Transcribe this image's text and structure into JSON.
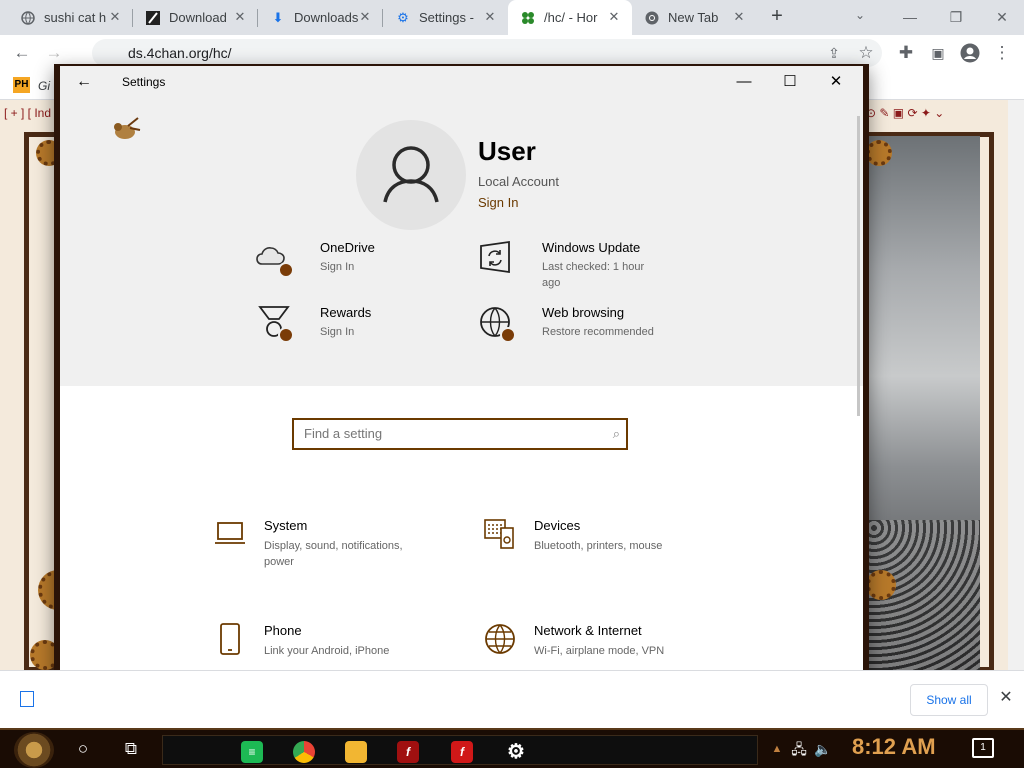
{
  "browser": {
    "tabs": [
      {
        "title": "sushi cat h",
        "icon": "globe-icon"
      },
      {
        "title": "Download",
        "icon": "download-page-icon"
      },
      {
        "title": "Downloads",
        "icon": "download-icon"
      },
      {
        "title": "Settings -",
        "icon": "gear-icon"
      },
      {
        "title": "/hc/ - Hor",
        "icon": "4chan-clover-icon",
        "active": true
      },
      {
        "title": "New Tab",
        "icon": "chrome-icon"
      }
    ],
    "url": "ds.4chan.org/hc/",
    "bookmark_label": "Gi",
    "bookmark_badge": "PH"
  },
  "webpage": {
    "nav_text": "[ + ] [ Ind"
  },
  "settings": {
    "window_title": "Settings",
    "user": {
      "name": "User",
      "account_type": "Local Account",
      "sign_in": "Sign In"
    },
    "quick_actions": [
      {
        "title": "OneDrive",
        "subtitle": "Sign In",
        "icon": "cloud-icon"
      },
      {
        "title": "Windows Update",
        "subtitle": "Last checked: 1 hour ago",
        "icon": "update-icon"
      },
      {
        "title": "Rewards",
        "subtitle": "Sign In",
        "icon": "medal-icon"
      },
      {
        "title": "Web browsing",
        "subtitle": "Restore recommended",
        "icon": "globe-icon"
      }
    ],
    "search_placeholder": "Find a setting",
    "categories": [
      {
        "title": "System",
        "subtitle": "Display, sound, notifications, power",
        "icon": "laptop-icon"
      },
      {
        "title": "Devices",
        "subtitle": "Bluetooth, printers, mouse",
        "icon": "keyboard-speaker-icon"
      },
      {
        "title": "Phone",
        "subtitle": "Link your Android, iPhone",
        "icon": "phone-icon"
      },
      {
        "title": "Network & Internet",
        "subtitle": "Wi-Fi, airplane mode, VPN",
        "icon": "network-globe-icon"
      }
    ]
  },
  "download_bar": {
    "show_all": "Show all"
  },
  "taskbar": {
    "time": "8:12 AM",
    "notification_count": "1"
  },
  "colors": {
    "accent": "#6b3a00",
    "badge": "#7a3c08",
    "clock": "#e0a050"
  }
}
